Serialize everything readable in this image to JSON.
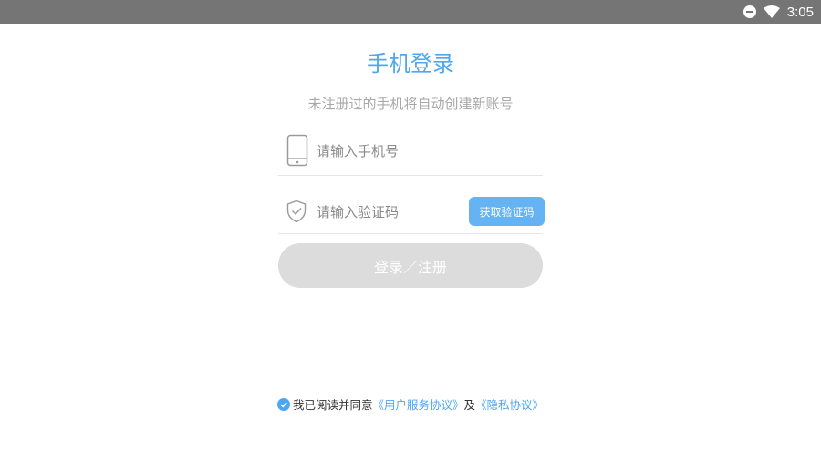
{
  "status_bar": {
    "time": "3:05",
    "icons": [
      "do-not-disturb-icon",
      "wifi-icon"
    ]
  },
  "title": "手机登录",
  "subtitle": "未注册过的手机将自动创建新账号",
  "phone": {
    "placeholder": "请输入手机号",
    "value": "",
    "icon": "phone-icon"
  },
  "code": {
    "placeholder": "请输入验证码",
    "value": "",
    "icon": "shield-icon",
    "button_label": "获取验证码"
  },
  "login_button_label": "登录／注册",
  "agreement": {
    "checked": true,
    "prefix": "我已阅读并同意",
    "user_terms_link": "《用户服务协议》",
    "and": "及",
    "privacy_link": "《隐私协议》"
  },
  "colors": {
    "accent": "#4ea7f2",
    "button": "#66b3f3",
    "login_disabled": "#dcdcdc",
    "statusbar": "#757575"
  }
}
